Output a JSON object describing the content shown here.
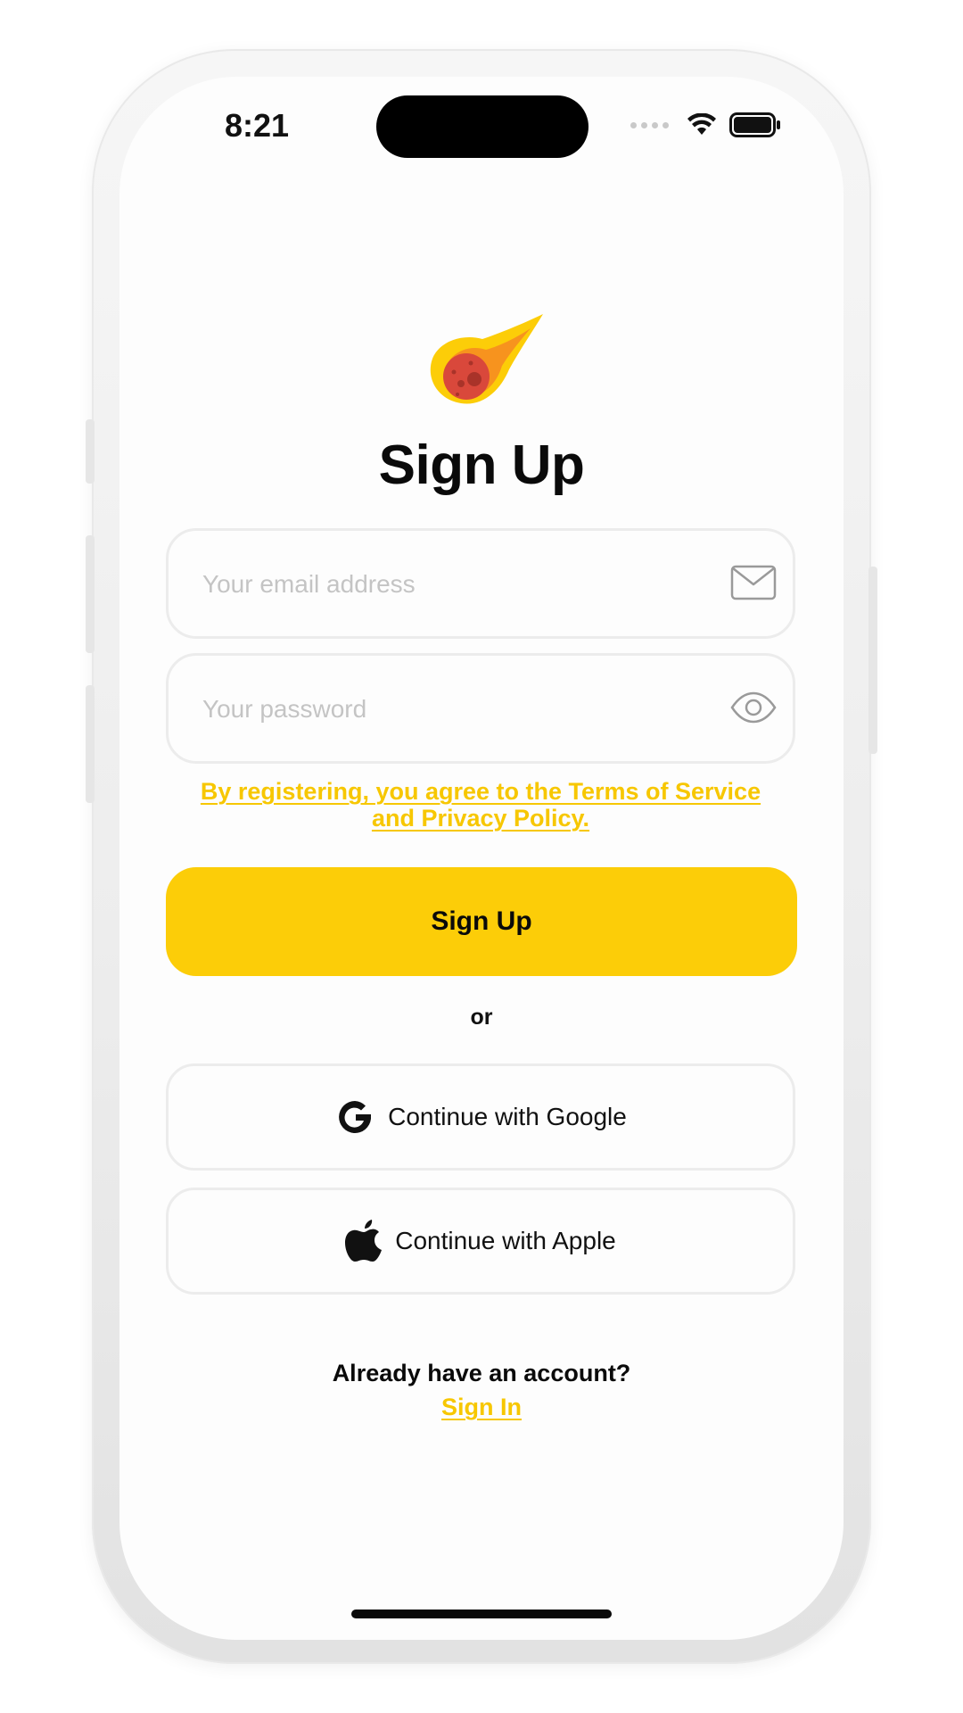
{
  "status_bar": {
    "time": "8:21"
  },
  "header": {
    "logo_icon": "comet-icon",
    "title": "Sign Up"
  },
  "form": {
    "email_placeholder": "Your email address",
    "email_icon": "envelope-icon",
    "password_placeholder": "Your password",
    "password_icon": "eye-icon",
    "terms_line1": "By registering, you agree to the Terms of Service",
    "terms_line2": "and Privacy Policy.",
    "submit_label": "Sign Up"
  },
  "divider": {
    "label": "or"
  },
  "social": {
    "google_label": "Continue with Google",
    "google_icon": "google-icon",
    "apple_label": "Continue with Apple",
    "apple_icon": "apple-icon"
  },
  "footer": {
    "prompt": "Already have an account?",
    "signin_label": "Sign In"
  },
  "colors": {
    "accent": "#fccd08",
    "link": "#f7c700",
    "field_border": "#ececec",
    "text": "#0a0a0a",
    "placeholder": "#c4c4c4"
  }
}
